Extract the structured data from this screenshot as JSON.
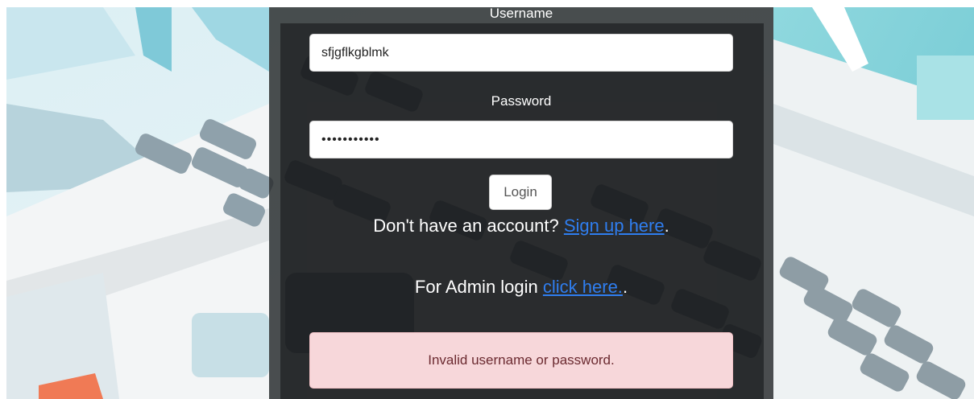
{
  "form": {
    "username_label": "Username",
    "username_value": "sfjgflkgblmk",
    "password_label": "Password",
    "password_value": "•••••••••••",
    "login_label": "Login"
  },
  "signup": {
    "prefix": "Don't have an account? ",
    "link": "Sign up here",
    "suffix": "."
  },
  "admin": {
    "prefix": "For Admin login ",
    "link": "click here.",
    "suffix": "."
  },
  "error": {
    "message": "Invalid username or password."
  },
  "colors": {
    "panel": "#26282a",
    "link": "#2f7ef0",
    "error_bg": "#f7d7da",
    "error_text": "#6b2a30",
    "background_accent": "#7fd3dc"
  }
}
